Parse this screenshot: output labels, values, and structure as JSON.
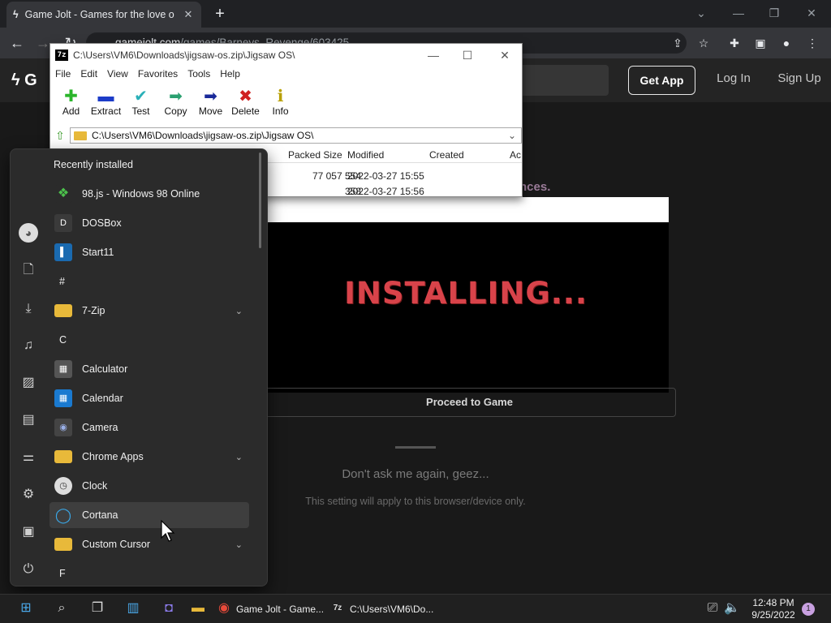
{
  "browser": {
    "tab_title": "Game Jolt - Games for the love o",
    "tab_close": "✕",
    "new_tab": "+",
    "url_host": "gamejolt.com",
    "url_path": "/games/Barneys_Revenge/603425"
  },
  "site": {
    "get_app": "Get App",
    "log_in": "Log In",
    "sign_up": "Sign Up",
    "prefs_fragment": "nces.",
    "overlay_text": "INSTALLING...",
    "proceed_button": "Proceed to Game",
    "dont_ask": "Don't ask me again, geez...",
    "apply_note": "This setting will apply to this browser/device only."
  },
  "zip": {
    "title": "C:\\Users\\VM6\\Downloads\\jigsaw-os.zip\\Jigsaw OS\\",
    "logo": "7z",
    "menu": [
      "File",
      "Edit",
      "View",
      "Favorites",
      "Tools",
      "Help"
    ],
    "tools": [
      {
        "label": "Add",
        "icon": "plus-icon",
        "glyph": "✚",
        "color": "#2bb52b"
      },
      {
        "label": "Extract",
        "icon": "minus-icon",
        "glyph": "▬",
        "color": "#1c3cc8"
      },
      {
        "label": "Test",
        "icon": "check-icon",
        "glyph": "✔",
        "color": "#2ab0b8"
      },
      {
        "label": "Copy",
        "icon": "copy-arrow-icon",
        "glyph": "➡",
        "color": "#2aa070"
      },
      {
        "label": "Move",
        "icon": "move-arrow-icon",
        "glyph": "➡",
        "color": "#1a2a9a"
      },
      {
        "label": "Delete",
        "icon": "delete-x-icon",
        "glyph": "✖",
        "color": "#d02020"
      },
      {
        "label": "Info",
        "icon": "info-icon",
        "glyph": "ℹ",
        "color": "#b8a000"
      }
    ],
    "address": "C:\\Users\\VM6\\Downloads\\jigsaw-os.zip\\Jigsaw OS\\",
    "columns": [
      "Packed Size",
      "Modified",
      "Created",
      "Ac"
    ],
    "rows": [
      {
        "packed": "77 057 554",
        "modified": "2022-03-27 15:55"
      },
      {
        "packed": "358",
        "modified": "2022-03-27 15:56"
      }
    ]
  },
  "start_menu": {
    "section_label": "Recently installed",
    "apps": [
      {
        "label": "98.js - Windows 98 Online",
        "icon": "windows98-icon",
        "glyph": "❖",
        "bg": "#2b2b2b"
      },
      {
        "label": "DOSBox",
        "icon": "dosbox-icon",
        "glyph": "D",
        "bg": "#3a3a3a"
      },
      {
        "label": "Start11",
        "icon": "start11-icon",
        "glyph": "▌",
        "bg": "#1a6ab0"
      },
      {
        "label": "7-Zip",
        "icon": "folder-icon",
        "glyph": "",
        "bg": "#e8b93a"
      },
      {
        "label": "Calculator",
        "icon": "calculator-icon",
        "glyph": "▦",
        "bg": "#555"
      },
      {
        "label": "Calendar",
        "icon": "calendar-icon",
        "glyph": "▦",
        "bg": "#1a7ad0"
      },
      {
        "label": "Camera",
        "icon": "camera-icon",
        "glyph": "◉",
        "bg": "#444"
      },
      {
        "label": "Chrome Apps",
        "icon": "folder-icon",
        "glyph": "",
        "bg": "#e8b93a"
      },
      {
        "label": "Clock",
        "icon": "clock-icon",
        "glyph": "◷",
        "bg": "#ddd"
      },
      {
        "label": "Cortana",
        "icon": "cortana-icon",
        "glyph": "◯",
        "bg": "#2b2b2b"
      },
      {
        "label": "Custom Cursor",
        "icon": "folder-icon",
        "glyph": "",
        "bg": "#e8b93a"
      }
    ],
    "letters": [
      "#",
      "C",
      "F"
    ]
  },
  "taskbar": {
    "chrome_label": "Game Jolt - Game...",
    "zip_label": "C:\\Users\\VM6\\Do...",
    "time": "12:48 PM",
    "date": "9/25/2022",
    "notif_count": "1"
  }
}
